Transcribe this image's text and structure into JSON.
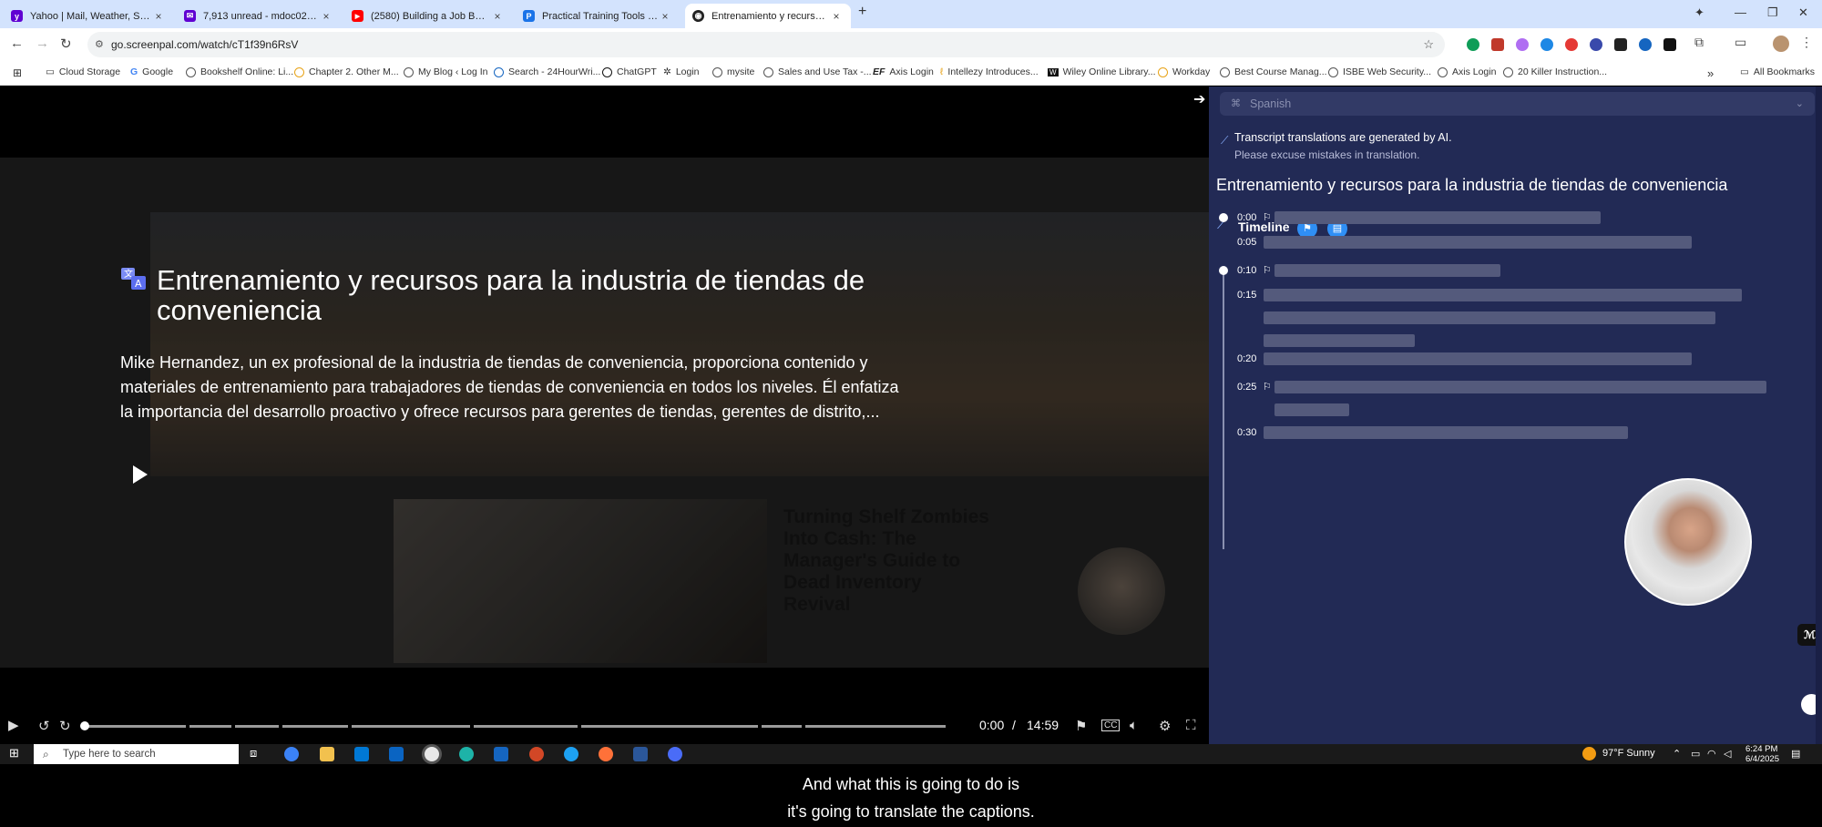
{
  "browser": {
    "tabs": [
      {
        "title": "Yahoo | Mail, Weather, Search, P",
        "favicon_color": "#6001d2",
        "favicon_glyph": "y"
      },
      {
        "title": "7,913 unread - mdoc02307@ya",
        "favicon_color": "#6001d2",
        "favicon_glyph": "✉"
      },
      {
        "title": "(2580) Building a Job Board wit",
        "favicon_color": "#ff0000",
        "favicon_glyph": "▶"
      },
      {
        "title": "Practical Training Tools & Tips f",
        "favicon_color": "#1a73e8",
        "favicon_glyph": "P"
      },
      {
        "title": "Entrenamiento y recursos para",
        "favicon_color": "#222222",
        "favicon_glyph": "◉"
      }
    ],
    "url": "go.screenpal.com/watch/cT1f39n6RsV",
    "bookmarks": [
      "Cloud Storage",
      "Google",
      "Bookshelf Online: Li...",
      "Chapter 2. Other M...",
      "My Blog ‹ Log In",
      "Search - 24HourWri...",
      "ChatGPT",
      "Login",
      "mysite",
      "Sales and Use Tax -...",
      "Axis Login",
      "Intellezy Introduces...",
      "Wiley Online Library...",
      "Workday",
      "Best Course Manag...",
      "ISBE Web Security...",
      "Axis Login",
      "20 Killer Instruction..."
    ],
    "all_bookmarks": "All Bookmarks"
  },
  "video": {
    "title": "Entrenamiento y recursos para la industria de tiendas de conveniencia",
    "description": "Mike Hernandez, un ex profesional de la industria de tiendas de conveniencia, proporciona contenido y materiales de entrenamiento para trabajadores de tiendas de conveniencia en todos los niveles. Él enfatiza la importancia del desarrollo proactivo y ofrece recursos para gerentes de tiendas, gerentes de distrito,...",
    "thumb_text": "Turning Shelf Zombies Into Cash: The Manager's Guide to Dead Inventory Revival",
    "current_time": "0:00",
    "separator": "/",
    "duration": "14:59",
    "progress": 0
  },
  "panel": {
    "language": "Spanish",
    "ai_notice": "Transcript translations are generated by AI.",
    "ai_subnotice": "Please excuse mistakes in translation.",
    "title": "Entrenamiento y recursos para la industria de tiendas de conveniencia",
    "timeline_label": "Timeline",
    "entries": [
      {
        "time": "0:00",
        "bookmark": true,
        "dot": true,
        "lines": 1
      },
      {
        "time": "0:05",
        "bookmark": false,
        "dot": false,
        "lines": 1
      },
      {
        "time": "0:10",
        "bookmark": true,
        "dot": true,
        "lines": 1
      },
      {
        "time": "0:15",
        "bookmark": false,
        "dot": false,
        "lines": 3
      },
      {
        "time": "0:20",
        "bookmark": false,
        "dot": false,
        "lines": 1
      },
      {
        "time": "0:25",
        "bookmark": true,
        "dot": false,
        "lines": 2
      },
      {
        "time": "0:30",
        "bookmark": false,
        "dot": false,
        "lines": 1
      }
    ]
  },
  "taskbar": {
    "search_placeholder": "Type here to search",
    "weather": "97°F  Sunny",
    "time": "6:24 PM",
    "date": "6/4/2025"
  },
  "captions": {
    "line1": "And what this is going to do is",
    "line2": "it's going to translate the captions."
  }
}
